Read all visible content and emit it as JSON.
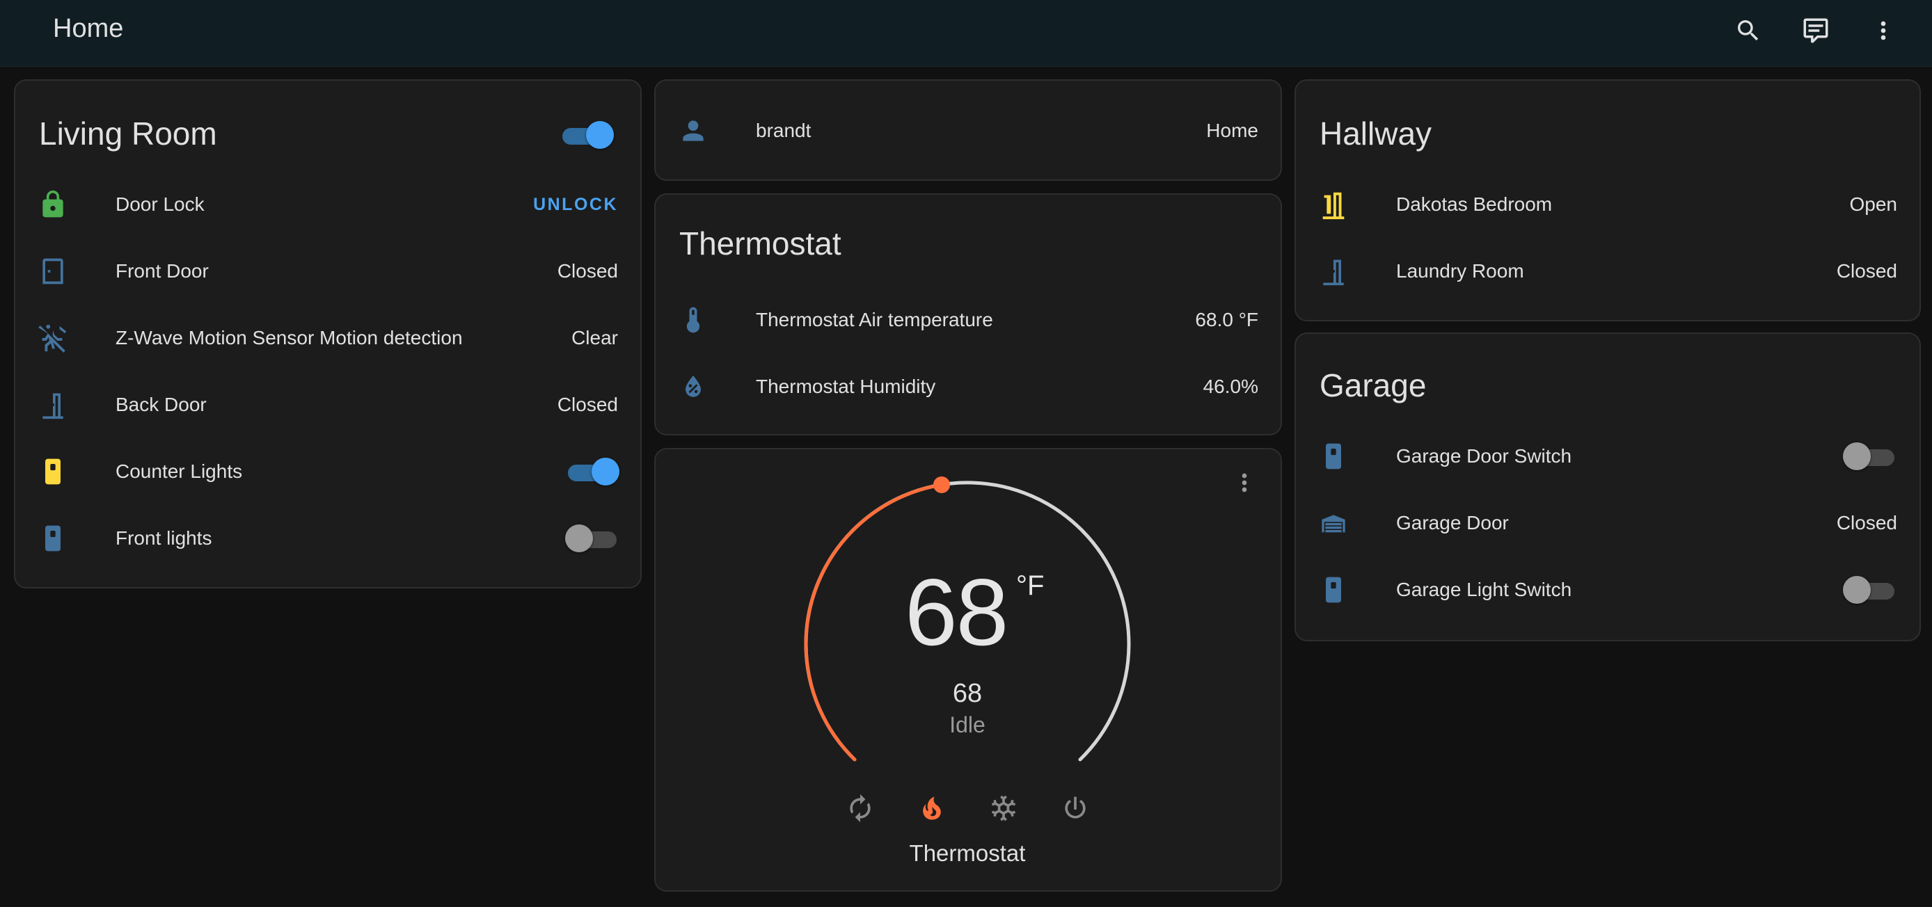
{
  "header": {
    "title": "Home",
    "icons": [
      "search-icon",
      "chat-icon",
      "more-vert-icon"
    ]
  },
  "living_room": {
    "title": "Living Room",
    "header_toggle_on": true,
    "rows": [
      {
        "name": "Door Lock",
        "icon": "lock-icon",
        "action": "UNLOCK",
        "icon_color": "#4caf50"
      },
      {
        "name": "Front Door",
        "icon": "door-closed-icon",
        "state": "Closed"
      },
      {
        "name": "Z-Wave Motion Sensor Motion detection",
        "icon": "motion-sensor-off-icon",
        "state": "Clear"
      },
      {
        "name": "Back Door",
        "icon": "door-closed-icon",
        "state": "Closed"
      },
      {
        "name": "Counter Lights",
        "icon": "light-switch-icon",
        "toggle_on": true,
        "icon_color": "#fdd93f"
      },
      {
        "name": "Front lights",
        "icon": "light-switch-icon",
        "toggle_on": false
      }
    ]
  },
  "person": {
    "name": "brandt",
    "icon": "account-icon",
    "state": "Home"
  },
  "thermostat_sensors": {
    "title": "Thermostat",
    "rows": [
      {
        "name": "Thermostat Air temperature",
        "icon": "thermometer-icon",
        "state": "68.0 °F"
      },
      {
        "name": "Thermostat Humidity",
        "icon": "water-percent-icon",
        "state": "46.0%"
      }
    ]
  },
  "thermostat_dial": {
    "current_temp": "68",
    "unit": "°F",
    "target_temp": "68",
    "hvac_action": "Idle",
    "name": "Thermostat",
    "modes": [
      "heat-cool-icon",
      "fire-icon",
      "snowflake-icon",
      "power-icon"
    ],
    "active_mode": "fire-icon",
    "heat_color": "#ff6f3c"
  },
  "hallway": {
    "title": "Hallway",
    "rows": [
      {
        "name": "Dakotas Bedroom",
        "icon": "door-open-icon",
        "state": "Open",
        "icon_color": "#fdd93f"
      },
      {
        "name": "Laundry Room",
        "icon": "door-closed-icon",
        "state": "Closed"
      }
    ]
  },
  "garage": {
    "title": "Garage",
    "rows": [
      {
        "name": "Garage Door Switch",
        "icon": "light-switch-icon",
        "toggle_on": false
      },
      {
        "name": "Garage Door",
        "icon": "garage-icon",
        "state": "Closed"
      },
      {
        "name": "Garage Light Switch",
        "icon": "light-switch-icon",
        "toggle_on": false
      }
    ]
  },
  "colors": {
    "accent": "#44a1f5",
    "icon_default": "#44739e",
    "card_bg": "#1c1c1c",
    "header_bg": "#101e24"
  }
}
